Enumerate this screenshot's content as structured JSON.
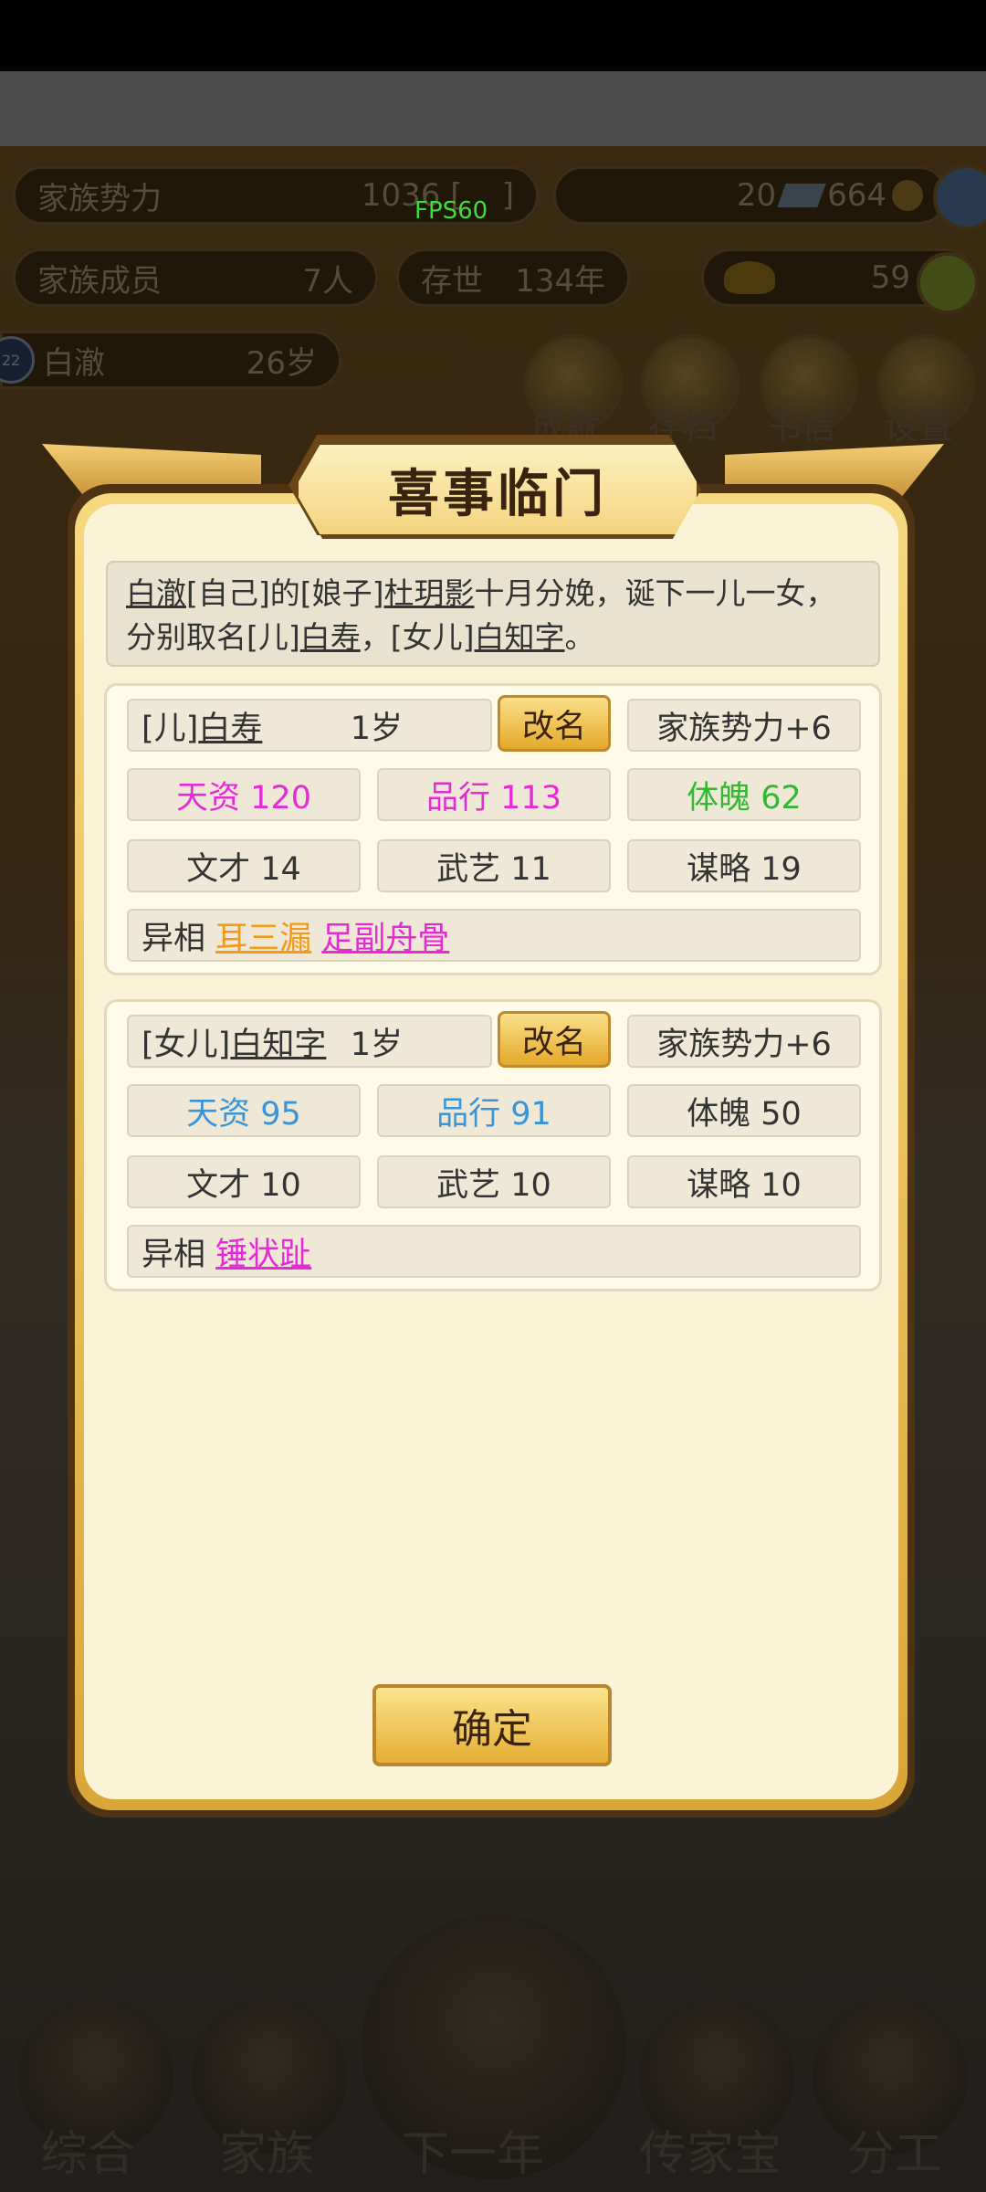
{
  "fps": "FPS60",
  "header": {
    "power_label": "家族势力",
    "power_value": "1036",
    "rank_hint": "[",
    "rank_end": "]",
    "currency_a": "20",
    "currency_b": "664",
    "members_label": "家族成员",
    "members_value": "7人",
    "existence_label": "存世",
    "existence_value": "134年",
    "gold_value": "59",
    "char_name": "白澈",
    "char_age": "26岁",
    "level_badge": "22"
  },
  "round_buttons": [
    "成就",
    "存档",
    "书信",
    "设置"
  ],
  "bottom_nav": [
    "综合",
    "家族",
    "下一年",
    "传家宝",
    "分工"
  ],
  "modal": {
    "title": "喜事临门",
    "announce": {
      "p1": "白澈",
      "p2": "[自己]的[娘子]",
      "p3": "杜玥影",
      "p4": "十月分娩，诞下一儿一女，",
      "p5": "分别取名[儿]",
      "p6": "白寿",
      "p7": "，[女儿]",
      "p8": "白知字",
      "p9": "。"
    },
    "children": [
      {
        "relation": "[儿]",
        "name": "白寿",
        "age": "1岁",
        "rename": "改名",
        "power": "家族势力+6",
        "talent": "天资 120",
        "conduct": "品行 113",
        "physique": "体魄 62",
        "literary": "文才 14",
        "martial": "武艺 11",
        "strategy": "谋略 19",
        "traits_label": "异相",
        "traits": [
          "耳三漏",
          "足副舟骨"
        ]
      },
      {
        "relation": "[女儿]",
        "name": "白知字",
        "age": "1岁",
        "rename": "改名",
        "power": "家族势力+6",
        "talent": "天资 95",
        "conduct": "品行 91",
        "physique": "体魄 50",
        "literary": "文才 10",
        "martial": "武艺 10",
        "strategy": "谋略 10",
        "traits_label": "异相",
        "traits": [
          "锤状趾"
        ]
      }
    ],
    "confirm": "确定"
  },
  "colors": {
    "magenta": "#e62bd6",
    "green": "#33b833",
    "blue": "#3a95d8",
    "orange": "#f29a1a",
    "gold": "#e5ae32"
  }
}
